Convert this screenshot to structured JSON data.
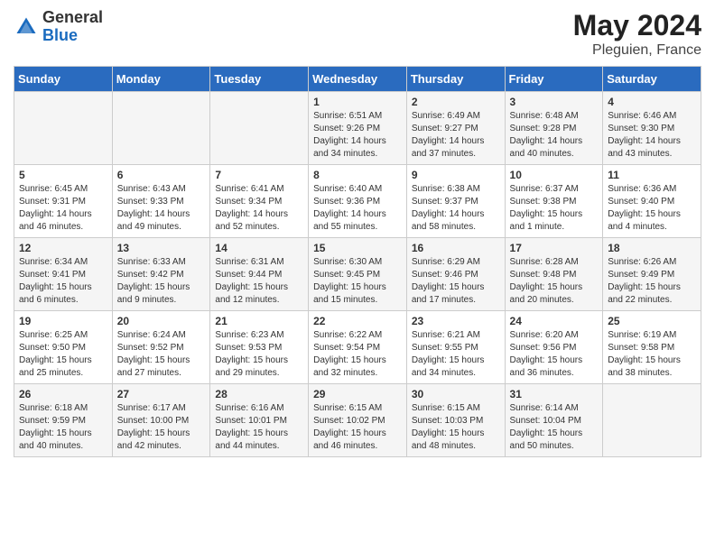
{
  "header": {
    "logo_general": "General",
    "logo_blue": "Blue",
    "title": "May 2024",
    "location": "Pleguien, France"
  },
  "calendar": {
    "days_of_week": [
      "Sunday",
      "Monday",
      "Tuesday",
      "Wednesday",
      "Thursday",
      "Friday",
      "Saturday"
    ],
    "weeks": [
      [
        {
          "day": "",
          "info": ""
        },
        {
          "day": "",
          "info": ""
        },
        {
          "day": "",
          "info": ""
        },
        {
          "day": "1",
          "info": "Sunrise: 6:51 AM\nSunset: 9:26 PM\nDaylight: 14 hours\nand 34 minutes."
        },
        {
          "day": "2",
          "info": "Sunrise: 6:49 AM\nSunset: 9:27 PM\nDaylight: 14 hours\nand 37 minutes."
        },
        {
          "day": "3",
          "info": "Sunrise: 6:48 AM\nSunset: 9:28 PM\nDaylight: 14 hours\nand 40 minutes."
        },
        {
          "day": "4",
          "info": "Sunrise: 6:46 AM\nSunset: 9:30 PM\nDaylight: 14 hours\nand 43 minutes."
        }
      ],
      [
        {
          "day": "5",
          "info": "Sunrise: 6:45 AM\nSunset: 9:31 PM\nDaylight: 14 hours\nand 46 minutes."
        },
        {
          "day": "6",
          "info": "Sunrise: 6:43 AM\nSunset: 9:33 PM\nDaylight: 14 hours\nand 49 minutes."
        },
        {
          "day": "7",
          "info": "Sunrise: 6:41 AM\nSunset: 9:34 PM\nDaylight: 14 hours\nand 52 minutes."
        },
        {
          "day": "8",
          "info": "Sunrise: 6:40 AM\nSunset: 9:36 PM\nDaylight: 14 hours\nand 55 minutes."
        },
        {
          "day": "9",
          "info": "Sunrise: 6:38 AM\nSunset: 9:37 PM\nDaylight: 14 hours\nand 58 minutes."
        },
        {
          "day": "10",
          "info": "Sunrise: 6:37 AM\nSunset: 9:38 PM\nDaylight: 15 hours\nand 1 minute."
        },
        {
          "day": "11",
          "info": "Sunrise: 6:36 AM\nSunset: 9:40 PM\nDaylight: 15 hours\nand 4 minutes."
        }
      ],
      [
        {
          "day": "12",
          "info": "Sunrise: 6:34 AM\nSunset: 9:41 PM\nDaylight: 15 hours\nand 6 minutes."
        },
        {
          "day": "13",
          "info": "Sunrise: 6:33 AM\nSunset: 9:42 PM\nDaylight: 15 hours\nand 9 minutes."
        },
        {
          "day": "14",
          "info": "Sunrise: 6:31 AM\nSunset: 9:44 PM\nDaylight: 15 hours\nand 12 minutes."
        },
        {
          "day": "15",
          "info": "Sunrise: 6:30 AM\nSunset: 9:45 PM\nDaylight: 15 hours\nand 15 minutes."
        },
        {
          "day": "16",
          "info": "Sunrise: 6:29 AM\nSunset: 9:46 PM\nDaylight: 15 hours\nand 17 minutes."
        },
        {
          "day": "17",
          "info": "Sunrise: 6:28 AM\nSunset: 9:48 PM\nDaylight: 15 hours\nand 20 minutes."
        },
        {
          "day": "18",
          "info": "Sunrise: 6:26 AM\nSunset: 9:49 PM\nDaylight: 15 hours\nand 22 minutes."
        }
      ],
      [
        {
          "day": "19",
          "info": "Sunrise: 6:25 AM\nSunset: 9:50 PM\nDaylight: 15 hours\nand 25 minutes."
        },
        {
          "day": "20",
          "info": "Sunrise: 6:24 AM\nSunset: 9:52 PM\nDaylight: 15 hours\nand 27 minutes."
        },
        {
          "day": "21",
          "info": "Sunrise: 6:23 AM\nSunset: 9:53 PM\nDaylight: 15 hours\nand 29 minutes."
        },
        {
          "day": "22",
          "info": "Sunrise: 6:22 AM\nSunset: 9:54 PM\nDaylight: 15 hours\nand 32 minutes."
        },
        {
          "day": "23",
          "info": "Sunrise: 6:21 AM\nSunset: 9:55 PM\nDaylight: 15 hours\nand 34 minutes."
        },
        {
          "day": "24",
          "info": "Sunrise: 6:20 AM\nSunset: 9:56 PM\nDaylight: 15 hours\nand 36 minutes."
        },
        {
          "day": "25",
          "info": "Sunrise: 6:19 AM\nSunset: 9:58 PM\nDaylight: 15 hours\nand 38 minutes."
        }
      ],
      [
        {
          "day": "26",
          "info": "Sunrise: 6:18 AM\nSunset: 9:59 PM\nDaylight: 15 hours\nand 40 minutes."
        },
        {
          "day": "27",
          "info": "Sunrise: 6:17 AM\nSunset: 10:00 PM\nDaylight: 15 hours\nand 42 minutes."
        },
        {
          "day": "28",
          "info": "Sunrise: 6:16 AM\nSunset: 10:01 PM\nDaylight: 15 hours\nand 44 minutes."
        },
        {
          "day": "29",
          "info": "Sunrise: 6:15 AM\nSunset: 10:02 PM\nDaylight: 15 hours\nand 46 minutes."
        },
        {
          "day": "30",
          "info": "Sunrise: 6:15 AM\nSunset: 10:03 PM\nDaylight: 15 hours\nand 48 minutes."
        },
        {
          "day": "31",
          "info": "Sunrise: 6:14 AM\nSunset: 10:04 PM\nDaylight: 15 hours\nand 50 minutes."
        },
        {
          "day": "",
          "info": ""
        }
      ]
    ]
  }
}
